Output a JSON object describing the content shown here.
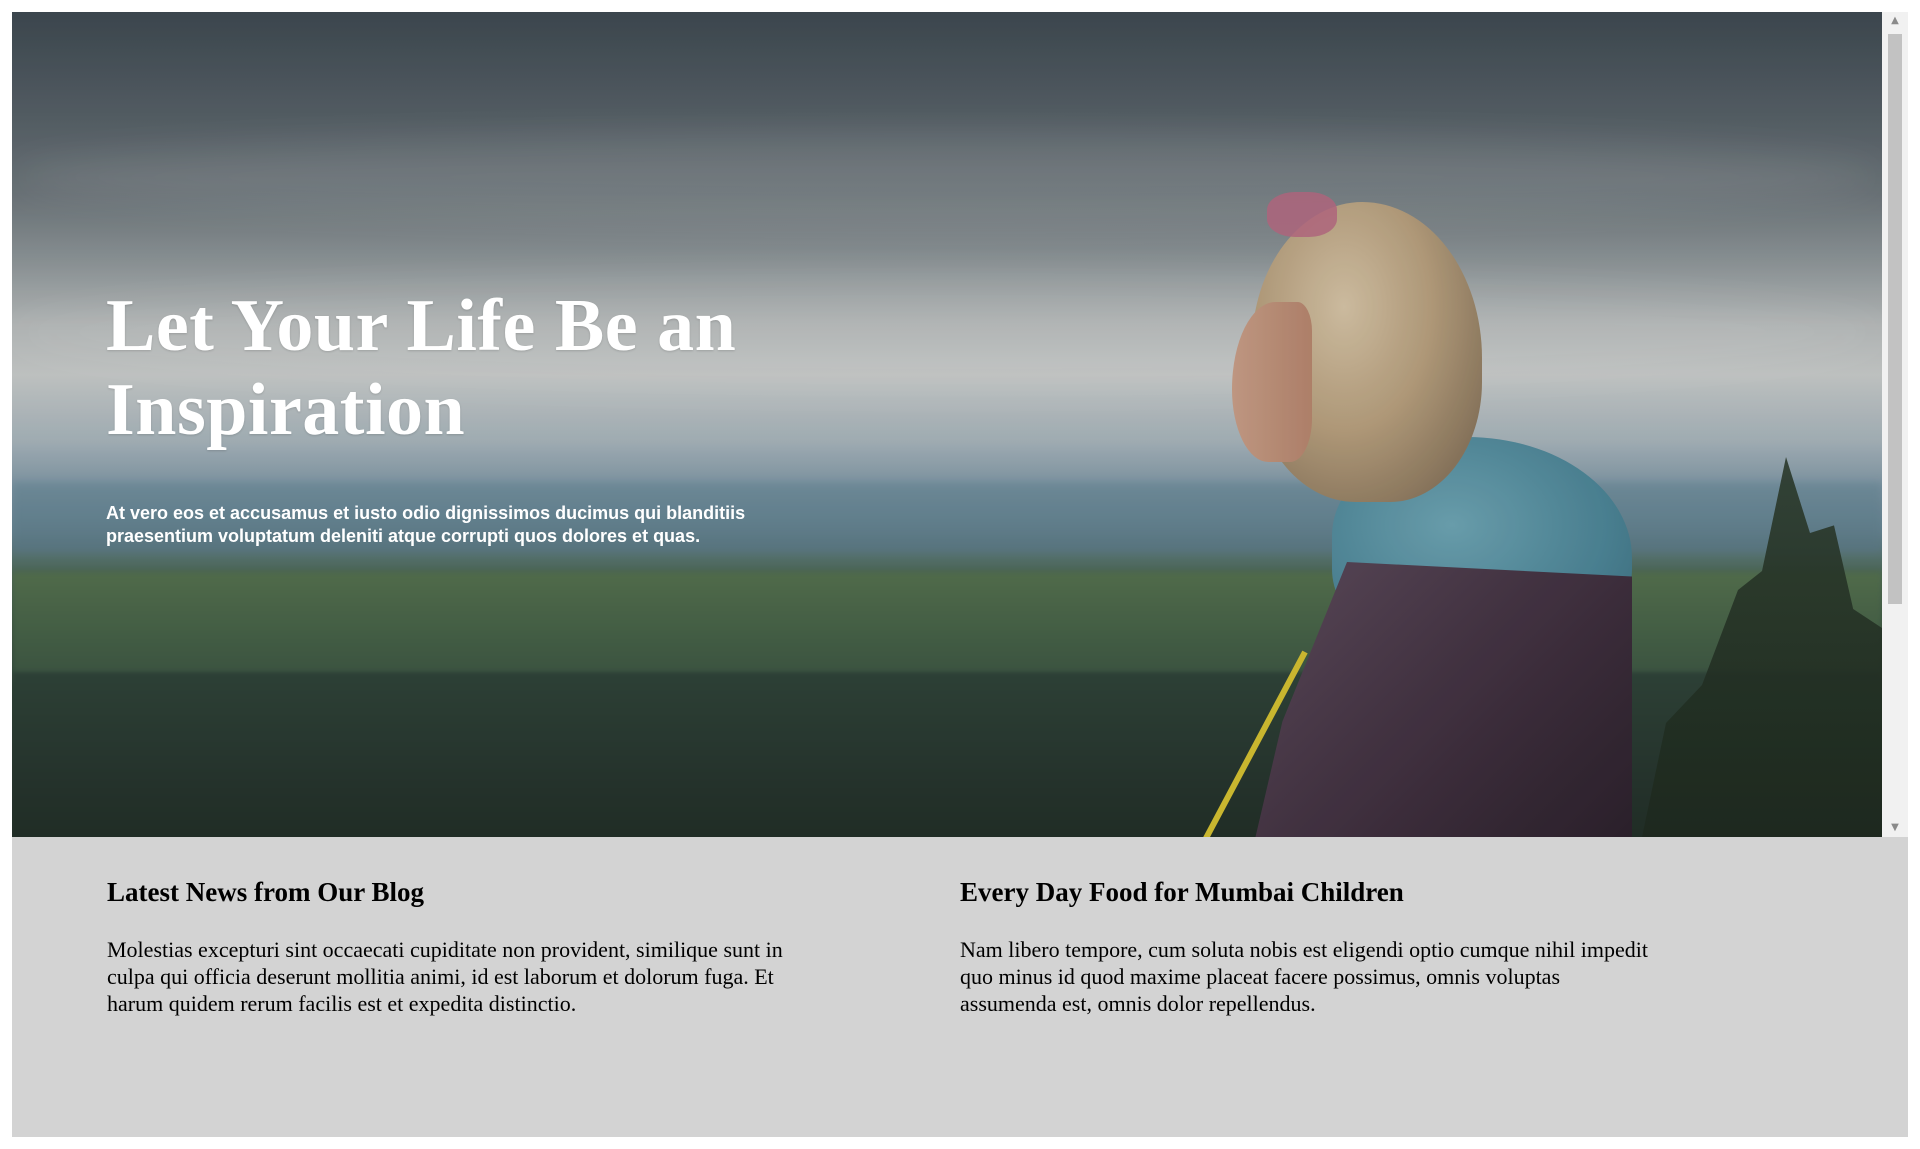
{
  "hero": {
    "title_line1": "Let Your Life Be an",
    "title_line2": "Inspiration",
    "text_line1": "At vero eos et accusamus et iusto odio dignissimos ducimus qui blanditiis",
    "text_line2": "praesentium voluptatum deleniti atque corrupti quos dolores et quas."
  },
  "sections": [
    {
      "title": "Latest News from Our Blog",
      "line1": "Molestias excepturi sint occaecati cupiditate non provident, similique sunt in",
      "line2": "culpa qui officia deserunt mollitia animi, id est laborum et dolorum fuga. Et",
      "line3": "harum quidem rerum facilis est et expedita distinctio."
    },
    {
      "title": "Every Day Food for Mumbai Children",
      "line1": "Nam libero tempore, cum soluta nobis est eligendi optio cumque nihil impedit",
      "line2": "quo minus id quod maxime placeat facere possimus, omnis voluptas",
      "line3": "assumenda est, omnis dolor repellendus."
    }
  ],
  "scrollbar": {
    "up_icon": "▲",
    "down_icon": "▼"
  },
  "colors": {
    "lower_background": "#d3d3d3",
    "hero_text": "#ffffff"
  }
}
